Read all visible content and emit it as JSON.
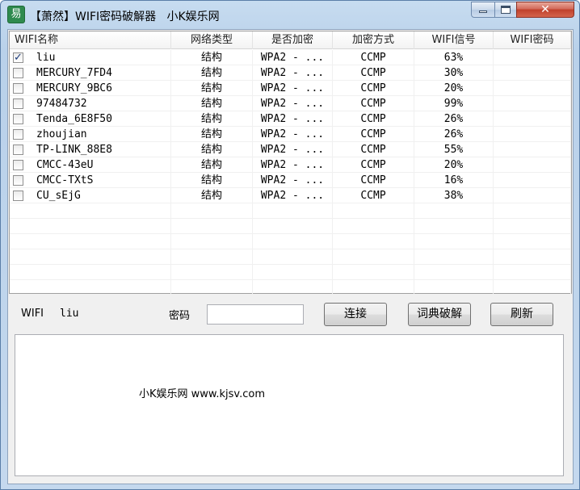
{
  "window": {
    "title": "【萧然】WIFI密码破解器   小K娱乐网",
    "icon": "app-logo-icon",
    "icon_glyph": "易"
  },
  "list": {
    "columns": [
      "WIFI名称",
      "网络类型",
      "是否加密",
      "加密方式",
      "WIFI信号",
      "WIFI密码"
    ],
    "rows": [
      {
        "checked": true,
        "name": "liu",
        "type": "结构",
        "encrypted": "WPA2 - ...",
        "method": "CCMP",
        "signal": "63%",
        "password": ""
      },
      {
        "checked": false,
        "name": "MERCURY_7FD4",
        "type": "结构",
        "encrypted": "WPA2 - ...",
        "method": "CCMP",
        "signal": "30%",
        "password": ""
      },
      {
        "checked": false,
        "name": "MERCURY_9BC6",
        "type": "结构",
        "encrypted": "WPA2 - ...",
        "method": "CCMP",
        "signal": "20%",
        "password": ""
      },
      {
        "checked": false,
        "name": "97484732",
        "type": "结构",
        "encrypted": "WPA2 - ...",
        "method": "CCMP",
        "signal": "99%",
        "password": ""
      },
      {
        "checked": false,
        "name": "Tenda_6E8F50",
        "type": "结构",
        "encrypted": "WPA2 - ...",
        "method": "CCMP",
        "signal": "26%",
        "password": ""
      },
      {
        "checked": false,
        "name": "zhoujian",
        "type": "结构",
        "encrypted": "WPA2 - ...",
        "method": "CCMP",
        "signal": "26%",
        "password": ""
      },
      {
        "checked": false,
        "name": "TP-LINK_88E8",
        "type": "结构",
        "encrypted": "WPA2 - ...",
        "method": "CCMP",
        "signal": "55%",
        "password": ""
      },
      {
        "checked": false,
        "name": "CMCC-43eU",
        "type": "结构",
        "encrypted": "WPA2 - ...",
        "method": "CCMP",
        "signal": "20%",
        "password": ""
      },
      {
        "checked": false,
        "name": "CMCC-TXtS",
        "type": "结构",
        "encrypted": "WPA2 - ...",
        "method": "CCMP",
        "signal": "16%",
        "password": ""
      },
      {
        "checked": false,
        "name": "CU_sEjG",
        "type": "结构",
        "encrypted": "WPA2 - ...",
        "method": "CCMP",
        "signal": "38%",
        "password": ""
      }
    ]
  },
  "controls": {
    "wifi_label": "WIFI",
    "wifi_value": "liu",
    "password_label": "密码",
    "password_value": "",
    "connect_label": "连接",
    "dict_label": "词典破解",
    "refresh_label": "刷新"
  },
  "output": {
    "text": "小K娱乐网 www.kjsv.com"
  },
  "colors": {
    "close_button": "#c0402b",
    "title_gradient": "#b9d1ea"
  }
}
